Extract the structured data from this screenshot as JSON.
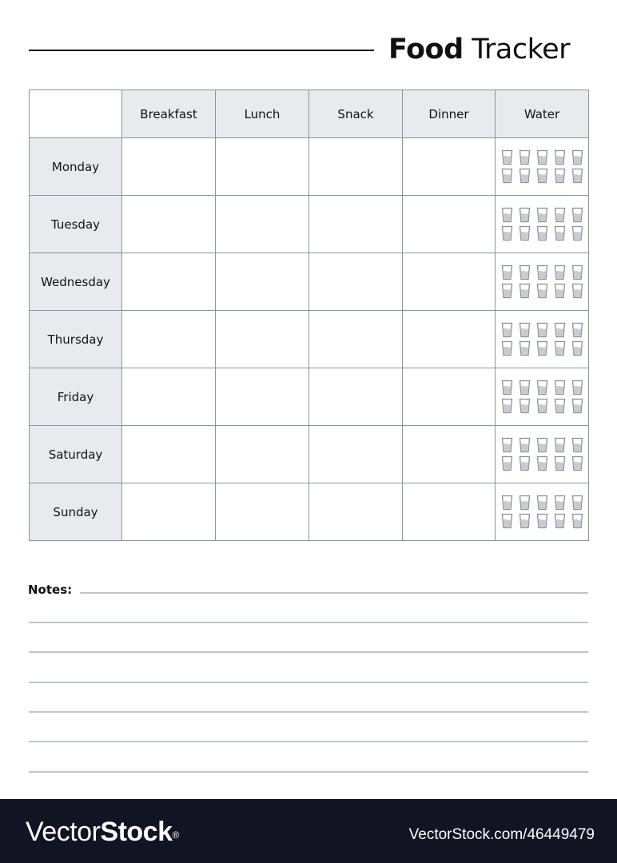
{
  "header": {
    "title_bold": "Food",
    "title_light": "Tracker"
  },
  "table": {
    "columns": [
      "Breakfast",
      "Lunch",
      "Snack",
      "Dinner",
      "Water"
    ],
    "days": [
      "Monday",
      "Tuesday",
      "Wednesday",
      "Thursday",
      "Friday",
      "Saturday",
      "Sunday"
    ],
    "water_glasses_per_day": 10
  },
  "notes": {
    "label": "Notes:",
    "line_count": 7
  },
  "footer": {
    "brand_thin": "Vector",
    "brand_bold": "Stock",
    "brand_mark": "®",
    "image_id": "VectorStock.com/46449479"
  },
  "colors": {
    "grid": "#8c939c",
    "header_fill": "#e8ebee",
    "footer_bg": "#121424",
    "glass_outline": "#8a9099",
    "glass_fill": "#c8ccd1"
  }
}
